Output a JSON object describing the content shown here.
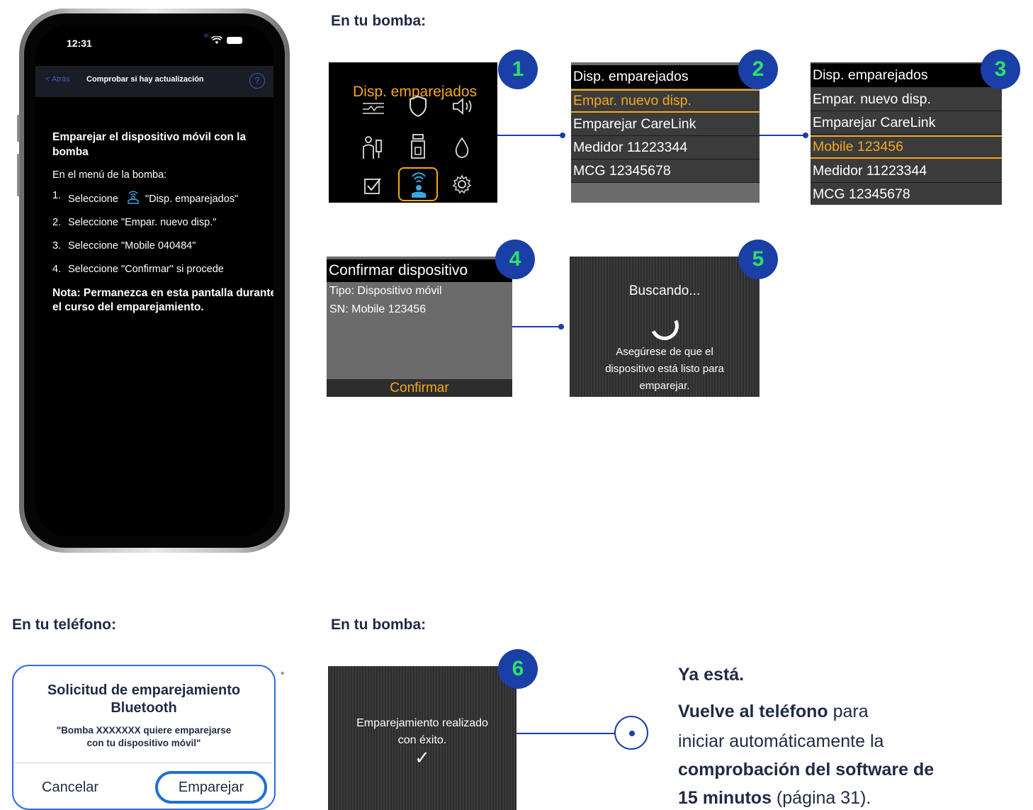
{
  "phone": {
    "status_time": "12:31",
    "nav_back": "< Atrás",
    "nav_title": "Comprobar si hay actualización",
    "help_icon": "?",
    "heading": "Emparejar el dispositivo móvil con la bomba",
    "subheading": "En el menú de la bomba:",
    "steps": [
      {
        "num": "1.",
        "before": "Seleccione",
        "after": "\"Disp. emparejados\""
      },
      {
        "num": "2.",
        "text": "Seleccione \"Empar. nuevo disp.\""
      },
      {
        "num": "3.",
        "text": "Seleccione \"Mobile 040484\""
      },
      {
        "num": "4.",
        "text": "Seleccione \"Confirmar\" si procede"
      }
    ],
    "note": "Nota: Permanezca en esta pantalla durante el curso del emparejamiento."
  },
  "sections": {
    "pump_top": "En tu bomba:",
    "phone_bottom": "En tu teléfono:",
    "pump_bottom": "En tu bomba:"
  },
  "screen1": {
    "badge": "1",
    "title": "Disp. emparejados",
    "icons": [
      "sensor-graph-icon",
      "shield-icon",
      "speaker-icon",
      "person-bolus-icon",
      "reservoir-icon",
      "drop-icon",
      "checkbox-icon",
      "paired-devices-icon",
      "settings-gear-icon"
    ]
  },
  "screen2": {
    "badge": "2",
    "rows": [
      "Disp. emparejados",
      "Empar. nuevo disp.",
      "Emparejar CareLink",
      "Medidor 11223344",
      "MCG 12345678"
    ]
  },
  "screen3": {
    "badge": "3",
    "rows": [
      "Disp. emparejados",
      "Empar. nuevo disp.",
      "Emparejar CareLink",
      "Mobile 123456",
      "Medidor 11223344",
      "MCG 12345678"
    ]
  },
  "screen4": {
    "badge": "4",
    "title": "Confirmar dispositivo",
    "type": "Tipo: Dispositivo móvil",
    "sn": "SN: Mobile 123456",
    "confirm": "Confirmar"
  },
  "screen5": {
    "badge": "5",
    "searching": "Buscando...",
    "line1": "Asegúrese de que el",
    "line2": "dispositivo está listo para",
    "line3": "emparejar."
  },
  "screen6": {
    "badge": "6",
    "line1": "Emparejamiento realizado",
    "line2": "con éxito.",
    "check": "✓"
  },
  "dialog": {
    "title_line1": "Solicitud de emparejamiento",
    "title_line2": "Bluetooth",
    "msg_line1": "\"Bomba XXXXXXX quiere emparejarse",
    "msg_line2": "con tu dispositivo móvil\"",
    "cancel": "Cancelar",
    "pair": "Emparejar",
    "asterisk": "*"
  },
  "final": {
    "done": "Ya está.",
    "back_bold": "Vuelve al teléfono",
    "back_rest": " para",
    "line2": "iniciar automáticamente la",
    "line3_bold": "comprobación del software de",
    "line4_bold": "15 minutos",
    "line4_rest": " (página 31)."
  },
  "colors": {
    "accent_blue": "#1a3fa6",
    "badge_number_green": "#2fe06b",
    "pump_highlight_orange": "#f4a81f"
  }
}
